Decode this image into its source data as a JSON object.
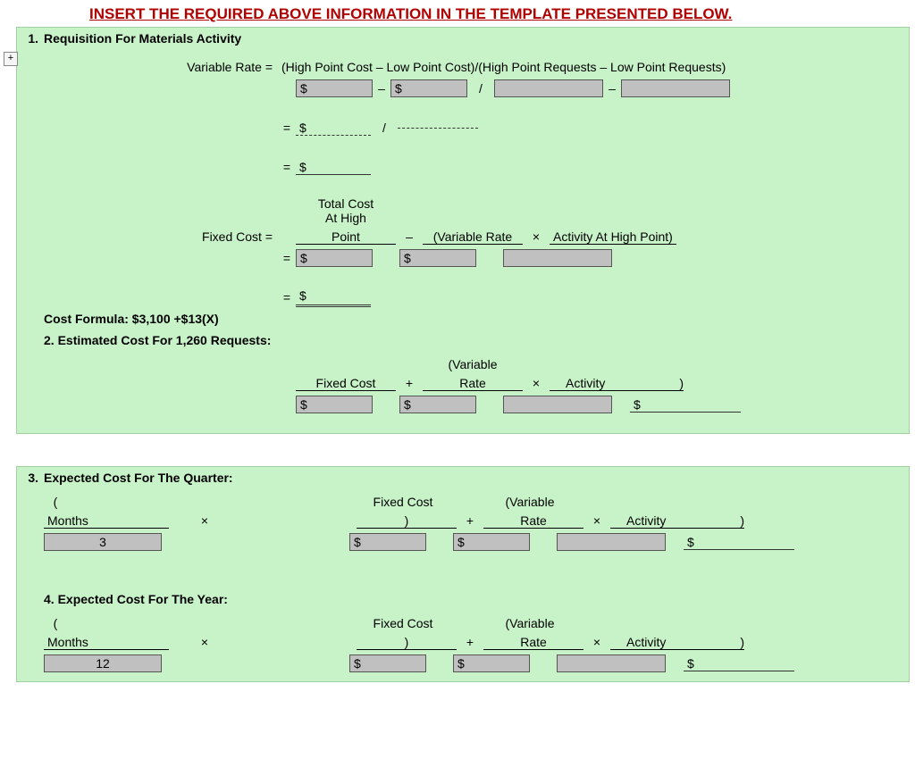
{
  "instruction": "INSERT THE REQUIRED ABOVE INFORMATION IN THE TEMPLATE PRESENTED BELOW.",
  "expand_symbol": "+",
  "section1": {
    "number": "1.",
    "title": "Requisition For Materials Activity",
    "variable_rate_label": "Variable Rate =",
    "variable_rate_formula": "(High Point Cost – Low Point Cost)/(High Point Requests – Low Point Requests)",
    "dollar": "$",
    "minus": "–",
    "divide": "/",
    "equals": "=",
    "fixed_cost_label": "Fixed Cost =",
    "hdr_total": "Total Cost At High Point",
    "hdr_total_line1": "Total Cost",
    "hdr_total_line2": "At High",
    "hdr_total_line3": "Point",
    "hdr_vrate_paren1": "(Variable Rate",
    "times": "×",
    "hdr_activity_high": "Activity At High Point)",
    "cost_formula": "Cost Formula: $3,100  +$13(X)",
    "est_label": "2. Estimated Cost For 1,260 Requests:",
    "hdr_fixed": "Fixed Cost",
    "plus": "+",
    "hdr_vrate_paren2a": "(Variable",
    "hdr_vrate_paren2b": "Rate",
    "hdr_activity": "Activity",
    "close_paren": ")"
  },
  "section3": {
    "number": "3.",
    "title": "Expected Cost For The Quarter:",
    "open_paren": "(",
    "months_label": "Months",
    "times": "×",
    "months_value": "3",
    "hdr_fixed_line1": "Fixed Cost",
    "close_paren_line2": ")",
    "plus": "+",
    "hdr_vrate_a": "(Variable",
    "hdr_vrate_b": "Rate",
    "hdr_activity": "Activity",
    "close_paren": ")",
    "dollar": "$"
  },
  "section4": {
    "number": "4.",
    "title": "Expected Cost For The Year:",
    "open_paren": "(",
    "months_label": "Months",
    "times": "×",
    "months_value": "12",
    "hdr_fixed_line1": "Fixed Cost",
    "close_paren_line2": ")",
    "plus": "+",
    "hdr_vrate_a": "(Variable",
    "hdr_vrate_b": "Rate",
    "hdr_activity": "Activity",
    "close_paren": ")",
    "dollar": "$"
  }
}
